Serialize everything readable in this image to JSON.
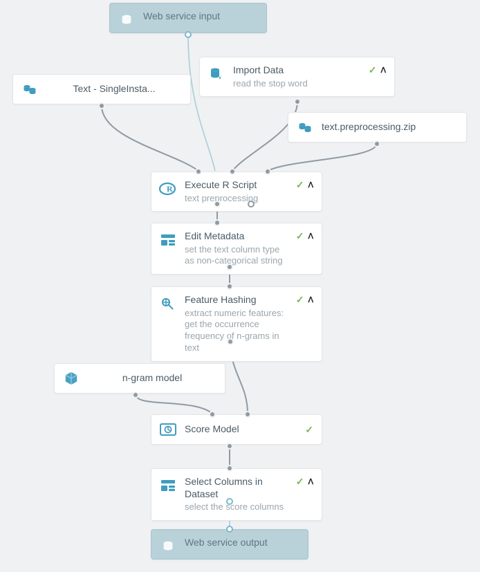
{
  "nodes": {
    "webInput": {
      "title": "Web service input"
    },
    "importData": {
      "title": "Import Data",
      "sub": "read the stop word"
    },
    "textSingle": {
      "title": "Text - SingleInsta..."
    },
    "textZip": {
      "title": "text.preprocessing.zip"
    },
    "execR": {
      "title": "Execute R Script",
      "sub": "text preprocessing"
    },
    "editMeta": {
      "title": "Edit Metadata",
      "sub": "set the text column type as non-categorical string"
    },
    "featHash": {
      "title": "Feature Hashing",
      "sub": "extract numeric features: get the occurrence frequency of n-grams in text"
    },
    "ngram": {
      "title": "n-gram model"
    },
    "scoreModel": {
      "title": "Score Model"
    },
    "selectCols": {
      "title": "Select Columns in Dataset",
      "sub": "select the score columns"
    },
    "webOutput": {
      "title": "Web service output"
    }
  },
  "glyphs": {
    "check": "✓",
    "chevron": "ᐱ"
  },
  "colors": {
    "teal": "#3f9cbf",
    "nodeBorder": "#e3e5e6",
    "subText": "#9aa6ad"
  }
}
